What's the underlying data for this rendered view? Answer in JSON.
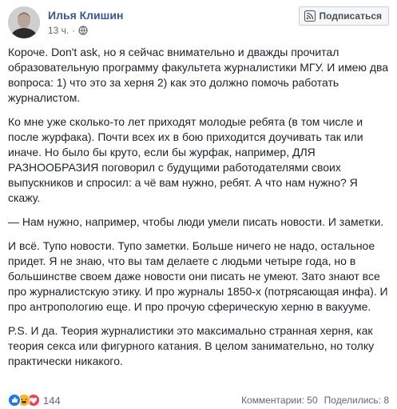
{
  "author": {
    "name": "Илья Клишин"
  },
  "post_meta": {
    "time": "13 ч."
  },
  "subscribe_button": {
    "label": "Подписаться"
  },
  "paragraphs": [
    "Короче. Don't ask, но я сейчас внимательно и дважды прочитал образовательную программу факультета журналистики МГУ. И имею два вопроса: 1) что это за херня 2) как это должно помочь работать журналистом.",
    "Ко мне уже сколько-то лет приходят молодые ребята (в том числе и после журфака). Почти всех их в бою приходится доучивать так или иначе. Но было бы круто, если бы журфак, например, ДЛЯ РАЗНООБРАЗИЯ поговорил с будущими работодателями своих выпускников и спросил: а чё вам нужно, ребят. А что нам нужно? Я скажу.",
    "— Нам нужно, например, чтобы люди умели писать новости. И заметки.",
    "И всё. Тупо новости. Тупо заметки. Больше ничего не надо, остальное придет. Я не знаю, что вы там делаете с людьми четыре года, но в большинстве своем даже новости они писать не умеют. Зато знают все про журналистскую этику. И про журналы 1850-х (потрясающая инфа). И про антропологию еще. И про прочую сферическую херню в вакууме.",
    "P.S. И да. Теория журналистики это максимально странная херня, как теория секса или фигурного катания. В целом занимательно, но толку практически никакого."
  ],
  "reactions": {
    "count": "144",
    "types": [
      "like-icon",
      "haha-icon",
      "love-icon"
    ],
    "colors": {
      "like": "#1877f2",
      "haha": "#f7b928",
      "love": "#f33e58"
    }
  },
  "stats": {
    "comments": "Комментарии: 50",
    "shares": "Поделились: 8"
  },
  "colors": {
    "author": "#385898",
    "text": "#1d2129",
    "secondary": "#616770"
  }
}
